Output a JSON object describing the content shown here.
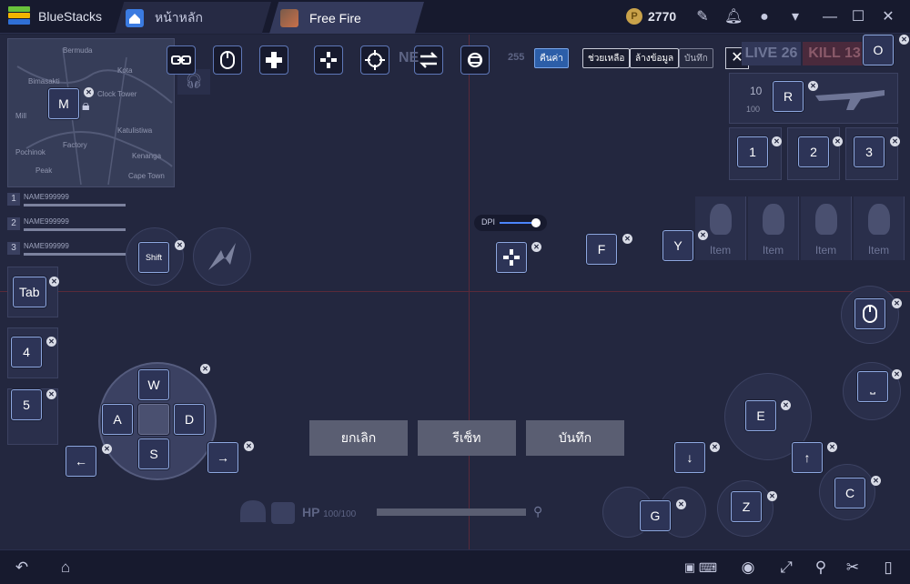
{
  "app": {
    "brand": "BlueStacks",
    "coins": "2770",
    "coin_symbol": "P",
    "accent": "#2c5ea8"
  },
  "tabs": [
    {
      "label": "หน้าหลัก",
      "icon": "home-icon"
    },
    {
      "label": "Free Fire",
      "icon": "game-icon"
    }
  ],
  "toolbar": {
    "tools": [
      "link-icon",
      "mouse-icon",
      "dpad-icon",
      "move-icon",
      "crosshair-icon",
      "swap-icon",
      "rotate-icon"
    ],
    "reset_label": "คืนค่า",
    "help_label": "ช่วยเหลือ",
    "clear_label": "ล้างข้อมูล",
    "save_label": "บันทึก"
  },
  "hud": {
    "live": "LIVE 26",
    "kill": "KILL 13",
    "compass_a": "NE",
    "compass_b": "255",
    "ammo_top": "10",
    "ammo_bottom": "100"
  },
  "players": [
    {
      "num": "1",
      "name": "NAME999999"
    },
    {
      "num": "2",
      "name": "NAME999999"
    },
    {
      "num": "3",
      "name": "NAME999999"
    }
  ],
  "minimap": {
    "places": [
      "Bimasakti",
      "Kota",
      "Clock Tower",
      "Mill",
      "Katulistiwa",
      "Peak",
      "Kenanga",
      "Cape Town",
      "Bermuda",
      "Factory",
      "Pochinok"
    ]
  },
  "items": [
    "Item",
    "Item",
    "Item",
    "Item"
  ],
  "keys": {
    "m": "M",
    "o": "O",
    "r": "R",
    "k1": "1",
    "k2": "2",
    "k3": "3",
    "shift": "Shift",
    "tab": "Tab",
    "k4": "4",
    "k5": "5",
    "f": "F",
    "y": "Y",
    "w": "W",
    "a": "A",
    "s": "S",
    "d": "D",
    "left": "←",
    "right": "→",
    "e": "E",
    "down": "↓",
    "up": "↑",
    "c": "C",
    "z": "Z",
    "g": "G",
    "space": "⎵"
  },
  "dpi": {
    "label": "DPI",
    "level": 0.9
  },
  "bottom_buttons": {
    "cancel": "ยกเลิก",
    "reset": "รีเซ็ท",
    "save": "บันทึก"
  },
  "hp": {
    "label": "HP",
    "value": "100/100"
  }
}
